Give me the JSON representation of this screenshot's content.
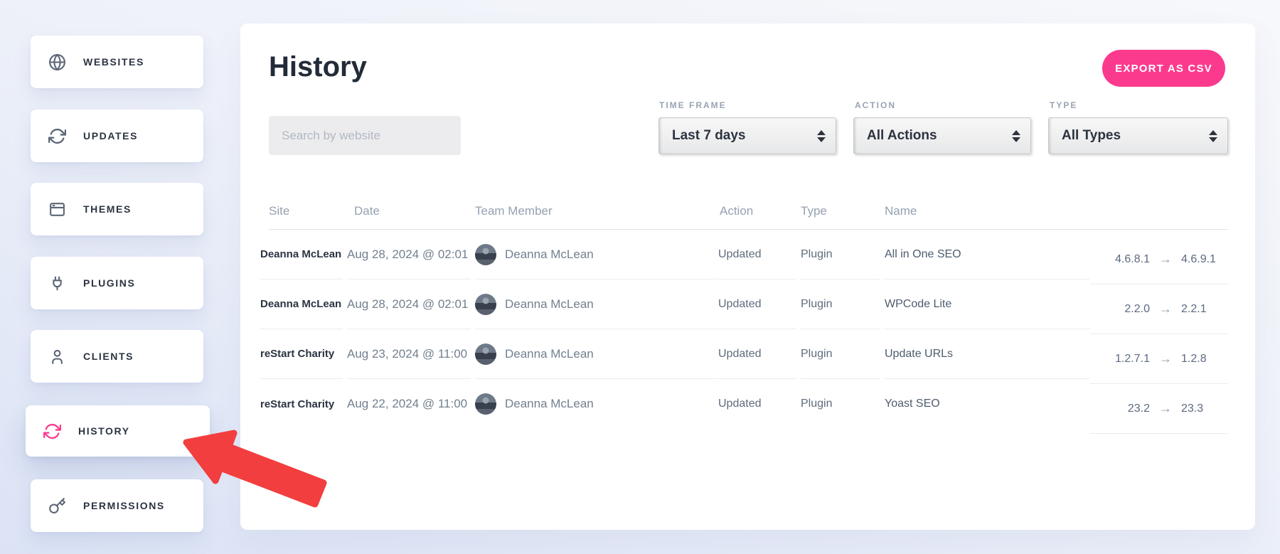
{
  "sidebar": {
    "items": [
      {
        "label": "WEBSITES",
        "icon": "globe-icon",
        "active": false
      },
      {
        "label": "UPDATES",
        "icon": "refresh-icon",
        "active": false
      },
      {
        "label": "THEMES",
        "icon": "window-icon",
        "active": false
      },
      {
        "label": "PLUGINS",
        "icon": "plug-icon",
        "active": false
      },
      {
        "label": "CLIENTS",
        "icon": "user-icon",
        "active": false
      },
      {
        "label": "HISTORY",
        "icon": "refresh-icon",
        "active": true
      },
      {
        "label": "PERMISSIONS",
        "icon": "key-icon",
        "active": false
      }
    ]
  },
  "page": {
    "title": "History",
    "export_button": "EXPORT AS CSV"
  },
  "search": {
    "placeholder": "Search by website"
  },
  "filters": [
    {
      "label": "TIME FRAME",
      "value": "Last 7 days"
    },
    {
      "label": "ACTION",
      "value": "All Actions"
    },
    {
      "label": "TYPE",
      "value": "All Types"
    }
  ],
  "table": {
    "columns": [
      "Site",
      "Date",
      "Team Member",
      "Action",
      "Type",
      "Name"
    ],
    "rows": [
      {
        "site": "Deanna McLean",
        "date": "Aug 28, 2024 @ 02:01",
        "team_member": "Deanna McLean",
        "action": "Updated",
        "type": "Plugin",
        "name": "All in One SEO",
        "version_from": "4.6.8.1",
        "version_to": "4.6.9.1"
      },
      {
        "site": "Deanna McLean",
        "date": "Aug 28, 2024 @ 02:01",
        "team_member": "Deanna McLean",
        "action": "Updated",
        "type": "Plugin",
        "name": "WPCode Lite",
        "version_from": "2.2.0",
        "version_to": "2.2.1"
      },
      {
        "site": "reStart Charity",
        "date": "Aug 23, 2024 @ 11:00",
        "team_member": "Deanna McLean",
        "action": "Updated",
        "type": "Plugin",
        "name": "Update URLs",
        "version_from": "1.2.7.1",
        "version_to": "1.2.8"
      },
      {
        "site": "reStart Charity",
        "date": "Aug 22, 2024 @ 11:00",
        "team_member": "Deanna McLean",
        "action": "Updated",
        "type": "Plugin",
        "name": "Yoast SEO",
        "version_from": "23.2",
        "version_to": "23.3"
      }
    ]
  },
  "icons": {
    "version_arrow": "→"
  },
  "colors": {
    "accent_pink": "#fb3a8e",
    "annotation_red": "#f23e3e",
    "icon_slate": "#5c6675"
  }
}
